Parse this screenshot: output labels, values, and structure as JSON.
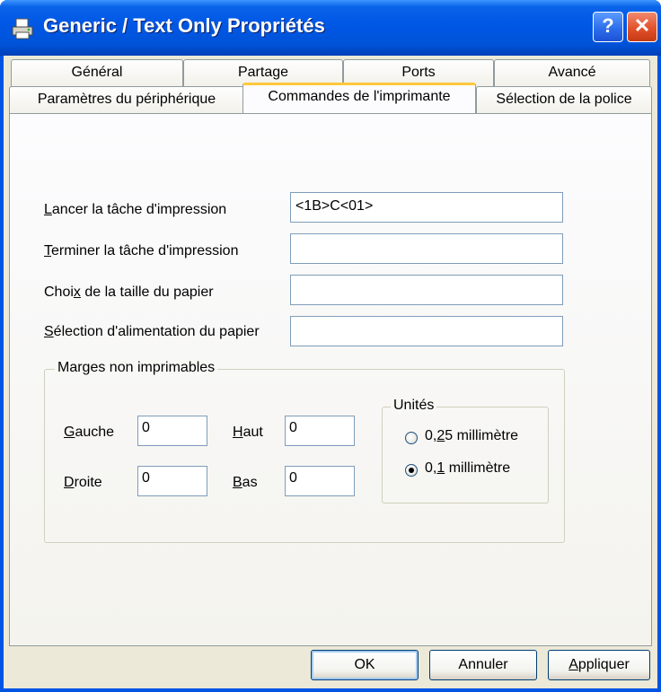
{
  "window": {
    "title": "Generic / Text Only Propriétés",
    "help_label": "?",
    "close_label": "✕"
  },
  "tabs_row1": [
    "Général",
    "Partage",
    "Ports",
    "Avancé"
  ],
  "tabs_row2": [
    "Paramètres du périphérique",
    "Commandes de l'imprimante",
    "Sélection de la police"
  ],
  "fields": {
    "start_job": {
      "label_key": "L",
      "label_rest": "ancer la tâche d'impression",
      "value": "<1B>C<01>"
    },
    "end_job": {
      "label_key": "T",
      "label_rest": "erminer la tâche d'impression",
      "value": ""
    },
    "paper_size": {
      "label_pre": "Choi",
      "label_key": "x",
      "label_rest": " de la taille du papier",
      "value": ""
    },
    "paper_feed": {
      "label_key": "S",
      "label_rest": "élection d'alimentation du papier",
      "value": ""
    }
  },
  "margins": {
    "title": "Marges non imprimables",
    "left": {
      "key": "G",
      "rest": "auche",
      "value": "0"
    },
    "right": {
      "key": "D",
      "rest": "roite",
      "value": "0"
    },
    "top": {
      "key": "H",
      "rest": "aut",
      "value": "0"
    },
    "bottom": {
      "key": "B",
      "rest": "as",
      "value": "0"
    },
    "units": {
      "title": "Unités",
      "opt1": {
        "pre": "0,",
        "key": "2",
        "rest": "5 millimètre",
        "selected": false
      },
      "opt2": {
        "pre": "0,",
        "key": "1",
        "rest": " millimètre",
        "selected": true
      }
    }
  },
  "buttons": {
    "ok": "OK",
    "cancel": "Annuler",
    "apply_key": "A",
    "apply_rest": "ppliquer"
  }
}
